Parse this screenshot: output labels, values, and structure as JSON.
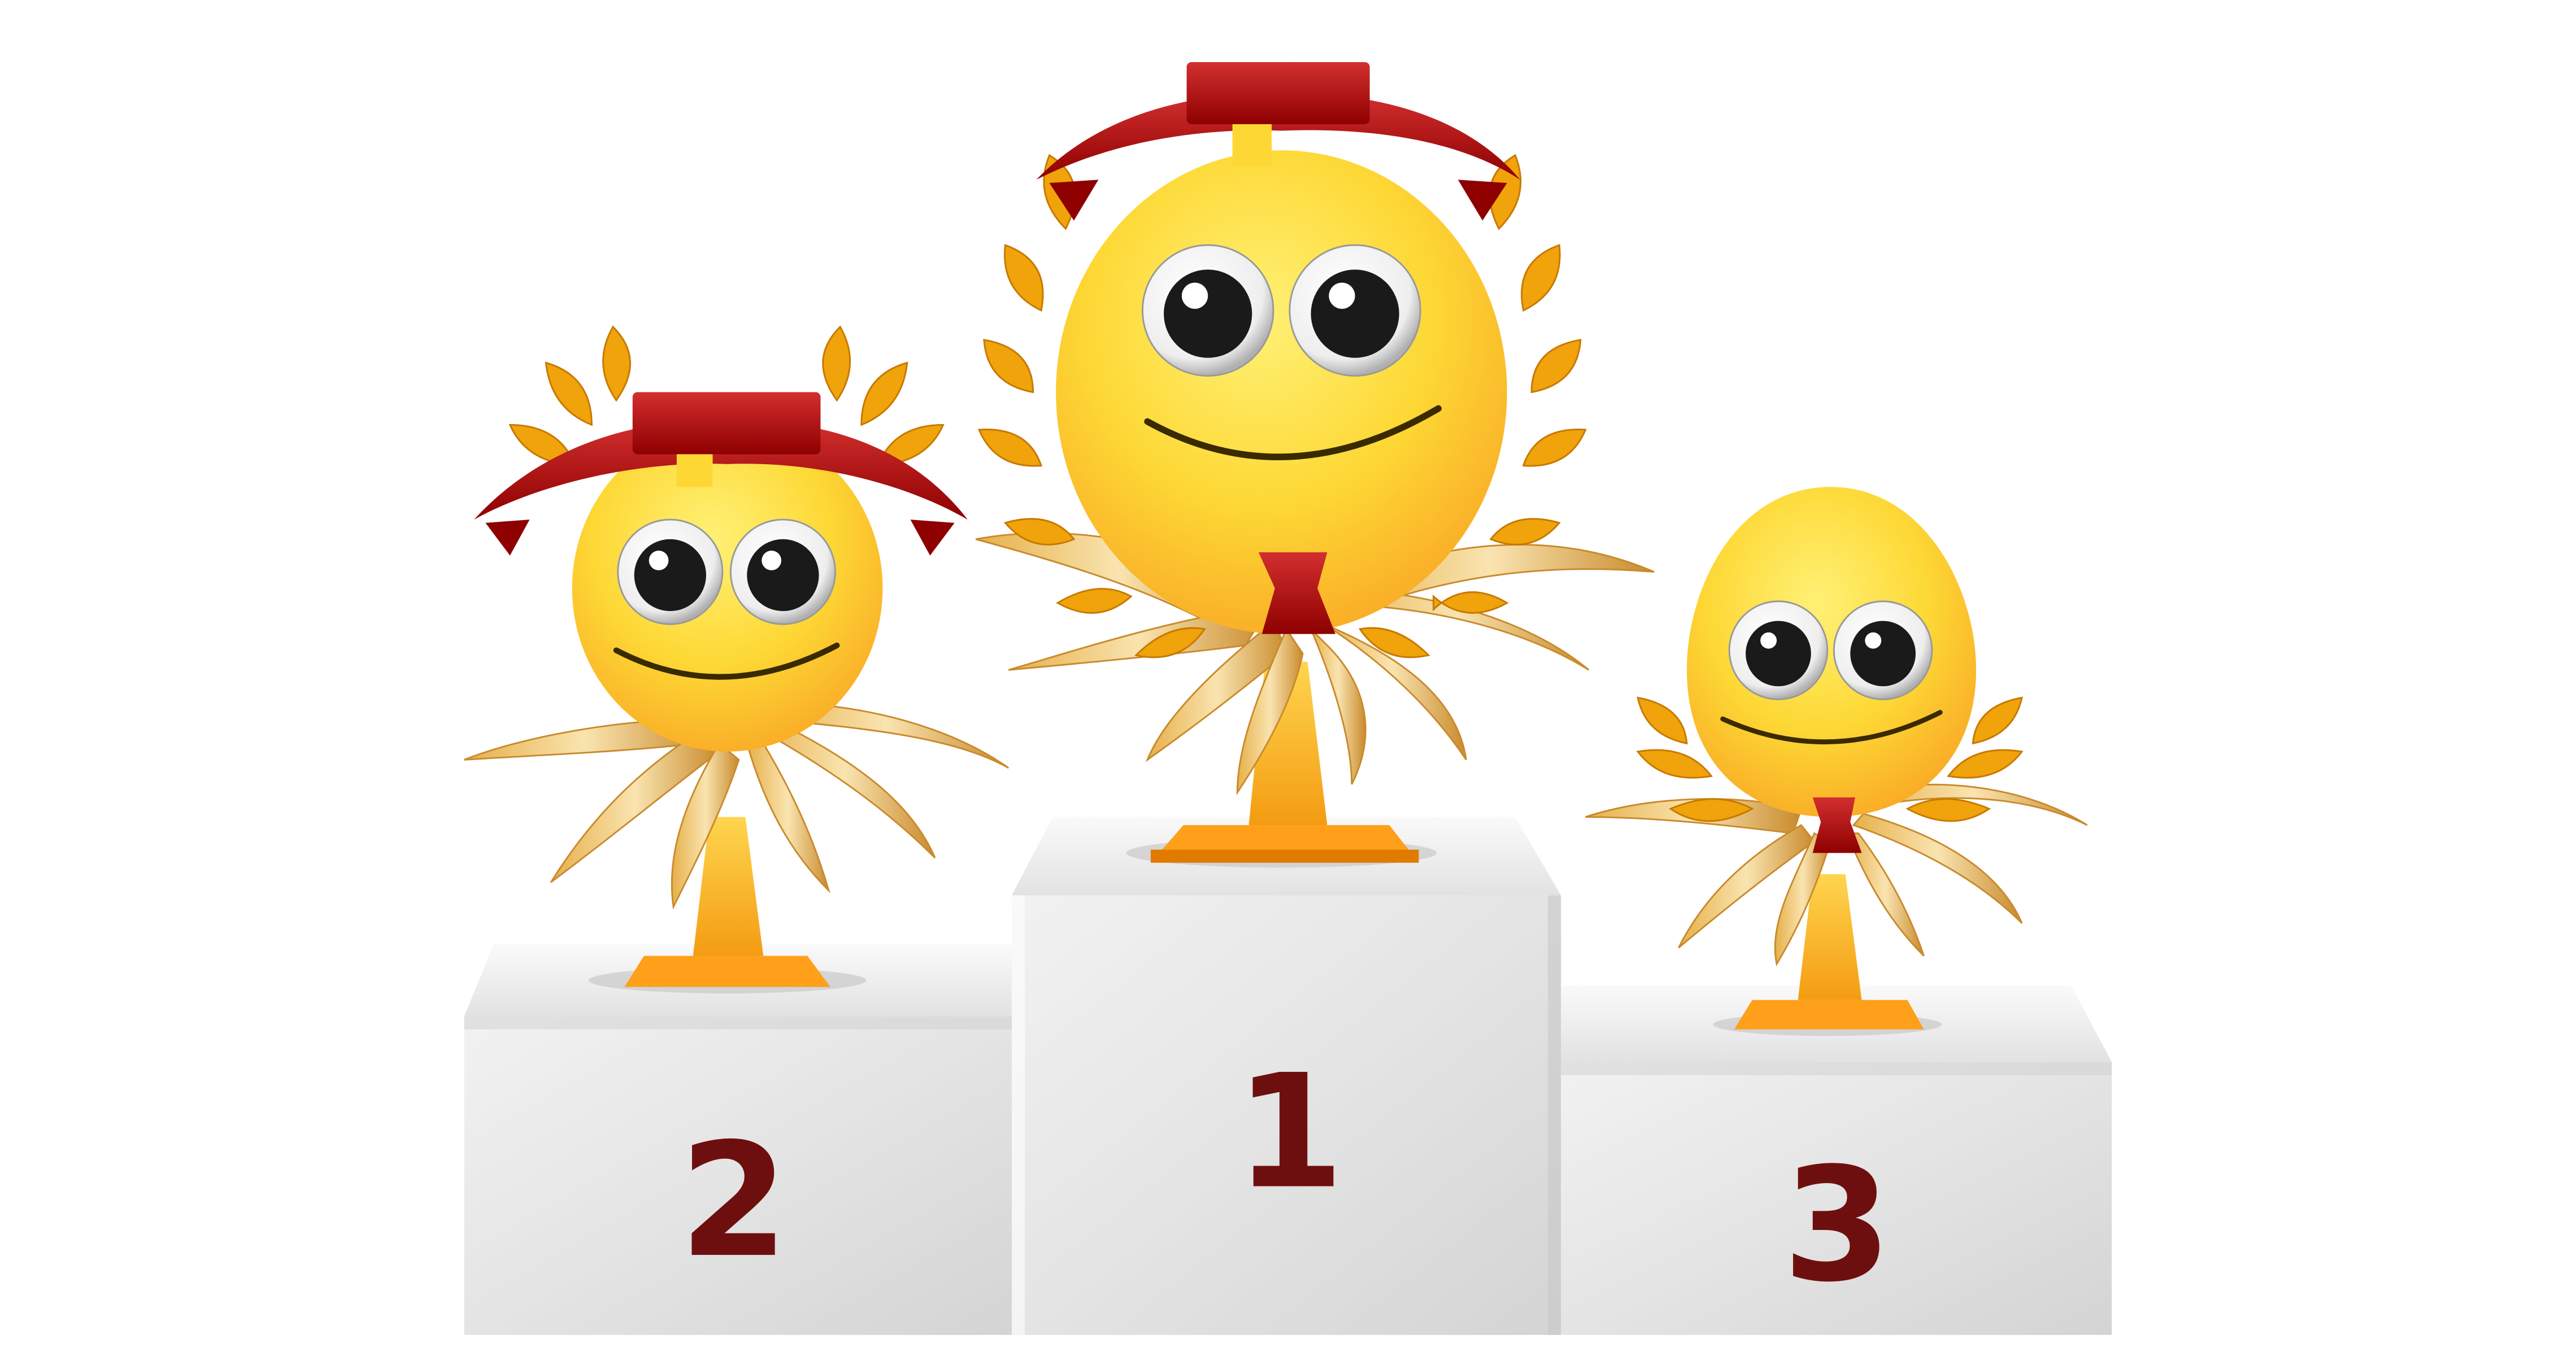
{
  "podium": {
    "places": [
      {
        "number": "2"
      },
      {
        "number": "1"
      },
      {
        "number": "3"
      }
    ]
  },
  "colors": {
    "background": "#ffffff",
    "number_text": "#6e0f0f",
    "emoji_face": "#fbc02d",
    "ribbon_red": "#b71c1c",
    "laurel_gold": "#f0a30a",
    "trophy_base": "#ff9f1a",
    "podium_front": "#e6e6e6",
    "podium_top": "#f6f6f6"
  }
}
